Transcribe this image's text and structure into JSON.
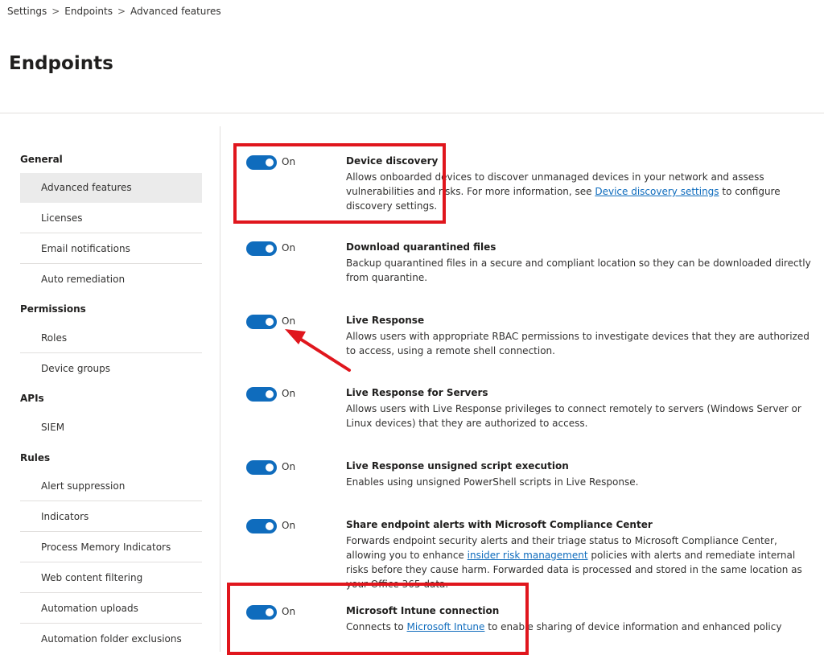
{
  "breadcrumb": {
    "items": [
      "Settings",
      "Endpoints",
      "Advanced features"
    ],
    "separator": ">"
  },
  "page": {
    "title": "Endpoints"
  },
  "sidebar": {
    "groups": [
      {
        "label": "General",
        "items": [
          "Advanced features",
          "Licenses",
          "Email notifications",
          "Auto remediation"
        ]
      },
      {
        "label": "Permissions",
        "items": [
          "Roles",
          "Device groups"
        ]
      },
      {
        "label": "APIs",
        "items": [
          "SIEM"
        ]
      },
      {
        "label": "Rules",
        "items": [
          "Alert suppression",
          "Indicators",
          "Process Memory Indicators",
          "Web content filtering",
          "Automation uploads",
          "Automation folder exclusions"
        ]
      }
    ],
    "active_item": "Advanced features"
  },
  "settings": [
    {
      "state": "On",
      "title": "Device discovery",
      "desc_before": "Allows onboarded devices to discover unmanaged devices in your network and assess vulnerabilities and risks. For more information, see ",
      "link": "Device discovery settings",
      "desc_after": " to configure discovery settings."
    },
    {
      "state": "On",
      "title": "Download quarantined files",
      "desc_before": "Backup quarantined files in a secure and compliant location so they can be downloaded directly from quarantine."
    },
    {
      "state": "On",
      "title": "Live Response",
      "desc_before": "Allows users with appropriate RBAC permissions to investigate devices that they are authorized to access, using a remote shell connection."
    },
    {
      "state": "On",
      "title": "Live Response for Servers",
      "desc_before": "Allows users with Live Response privileges to connect remotely to servers (Windows Server or Linux devices) that they are authorized to access."
    },
    {
      "state": "On",
      "title": "Live Response unsigned script execution",
      "desc_before": "Enables using unsigned PowerShell scripts in Live Response."
    },
    {
      "state": "On",
      "title": "Share endpoint alerts with Microsoft Compliance Center",
      "desc_before": "Forwards endpoint security alerts and their triage status to Microsoft Compliance Center, allowing you to enhance ",
      "link": "insider risk management",
      "desc_after": " policies with alerts and remediate internal risks before they cause harm. Forwarded data is processed and stored in the same location as your Office 365 data."
    },
    {
      "state": "On",
      "title": "Microsoft Intune connection",
      "desc_before": "Connects to ",
      "link": "Microsoft Intune",
      "desc_after": " to enable sharing of device information and enhanced policy"
    }
  ],
  "colors": {
    "accent": "#0f6cbd",
    "highlight": "#e0161d",
    "nav_active_bg": "#ebebeb"
  },
  "icons": {
    "breadcrumb_separator": "chevron-right-icon"
  }
}
